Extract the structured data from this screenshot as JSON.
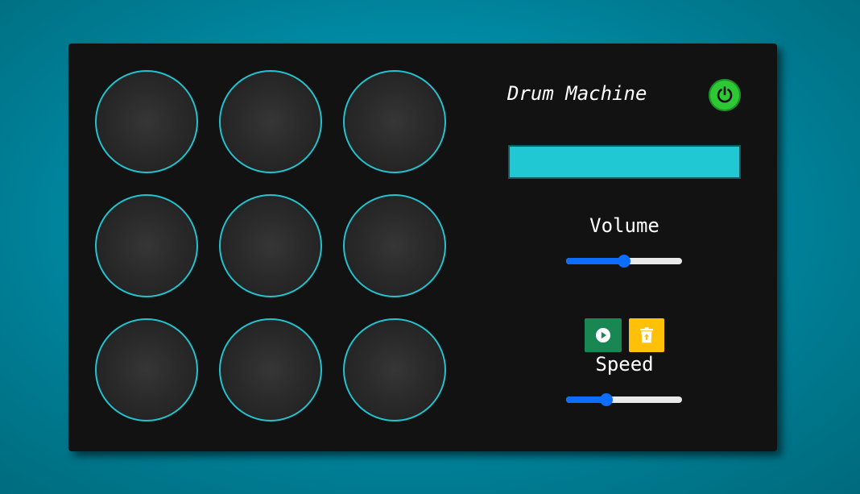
{
  "header": {
    "title": "Drum Machine"
  },
  "display": {
    "text": ""
  },
  "volume": {
    "label": "Volume",
    "value": 0.5
  },
  "speed": {
    "label": "Speed",
    "value": 0.35
  },
  "pads": [
    {
      "id": 1
    },
    {
      "id": 2
    },
    {
      "id": 3
    },
    {
      "id": 4
    },
    {
      "id": 5
    },
    {
      "id": 6
    },
    {
      "id": 7
    },
    {
      "id": 8
    },
    {
      "id": 9
    }
  ],
  "icons": {
    "power": "power-icon",
    "play": "play-icon",
    "clear": "trash-icon"
  },
  "colors": {
    "pad_border": "#22c3cf",
    "display_bg": "#1fc8d2",
    "power_on": "#2dc935",
    "play_button": "#198754",
    "clear_button": "#ffc107",
    "slider_accent": "#0d6efd",
    "panel_bg": "#121212"
  }
}
